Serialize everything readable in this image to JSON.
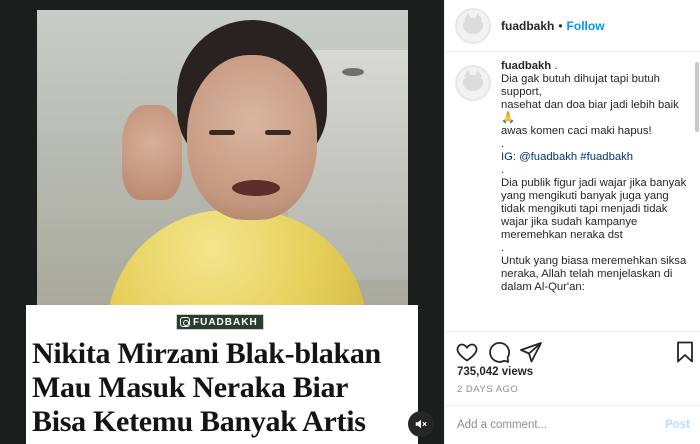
{
  "media": {
    "brand_tag": "FUADBAKH",
    "headline_lines": [
      "Nikita Mirzani Blak-blakan",
      "Mau Masuk Neraka Biar",
      "Bisa Ketemu Banyak Artis"
    ]
  },
  "header": {
    "username": "fuadbakh",
    "separator": "•",
    "follow_label": "Follow"
  },
  "caption": {
    "username": "fuadbakh",
    "lines": [
      ".",
      "Dia gak butuh dihujat tapi butuh",
      "support,",
      "nasehat dan doa biar jadi lebih baik",
      "🙏",
      "awas komen caci maki hapus!",
      ".",
      "IG: @fuadbakh #fuadbakh",
      ".",
      "Dia publik figur jadi wajar jika banyak",
      "yang mengikuti banyak juga yang",
      "tidak mengikuti tapi menjadi tidak",
      "wajar jika sudah kampanye",
      "meremehkan neraka dst",
      ".",
      "Untuk yang biasa meremehkan siksa",
      "neraka, Allah telah menjelaskan di",
      "dalam Al-Qur'an:"
    ]
  },
  "stats": {
    "views": "735,042 views",
    "timestamp": "2 DAYS AGO"
  },
  "comment_box": {
    "placeholder": "Add a comment...",
    "post_label": "Post"
  }
}
